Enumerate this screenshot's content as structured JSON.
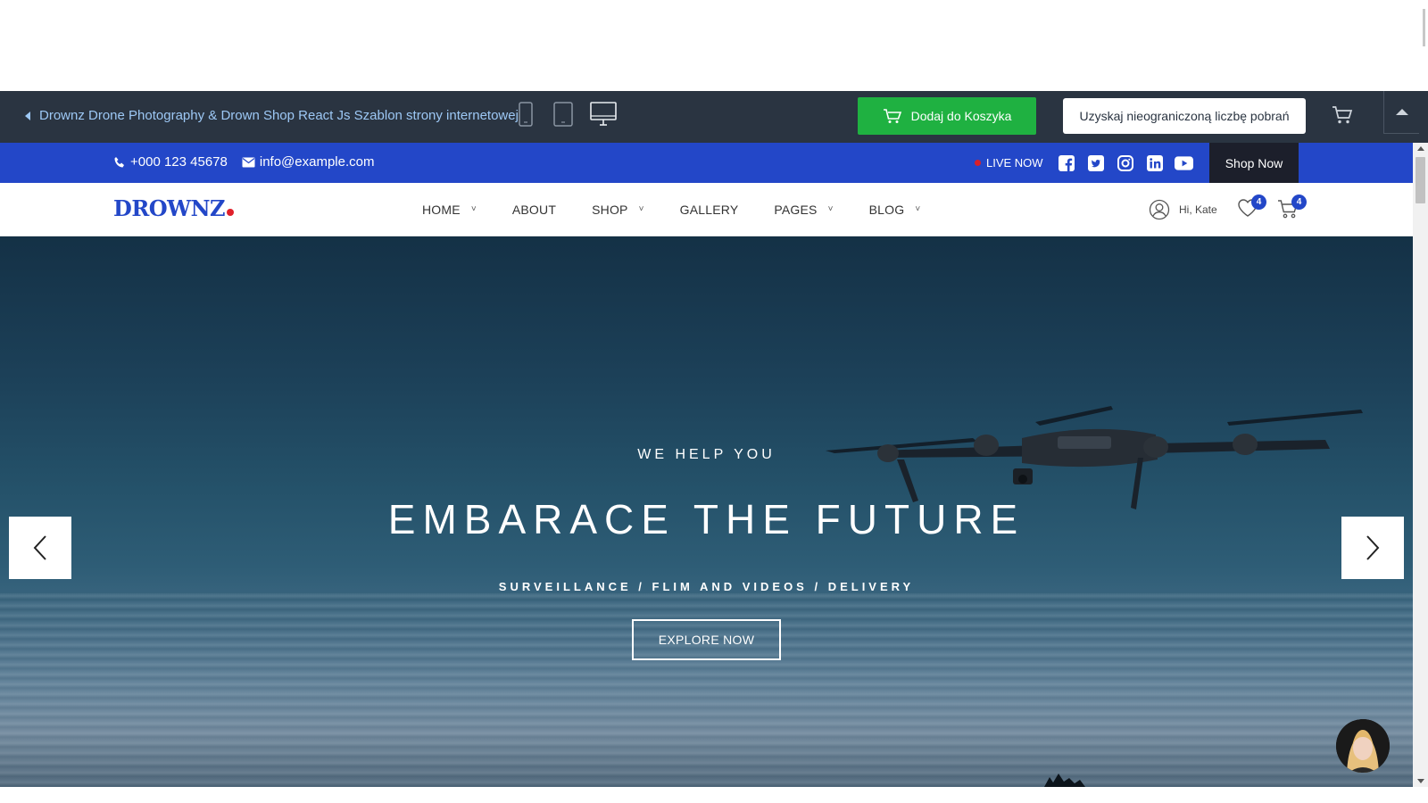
{
  "preview_bar": {
    "back_label": "Drownz Drone Photography & Drown Shop React Js Szablon strony internetowej",
    "devices": [
      "phone-icon",
      "tablet-icon",
      "desktop-icon"
    ],
    "add_to_cart_label": "Dodaj do Koszyka",
    "unlimited_label": "Uzyskaj nieograniczoną liczbę pobrań",
    "colors": {
      "bar": "#2a3441",
      "add_to_cart": "#1fb141",
      "link": "#9dc8f5"
    }
  },
  "info_bar": {
    "phone": "+000 123 45678",
    "email": "info@example.com",
    "live_label": "LIVE NOW",
    "socials": [
      "facebook-icon",
      "twitter-icon",
      "instagram-icon",
      "linkedin-icon",
      "youtube-icon"
    ],
    "shop_now_label": "Shop Now",
    "colors": {
      "bar": "#2347c8",
      "shop_now": "#1c1f2b",
      "live_dot": "#d81f2a"
    }
  },
  "nav": {
    "logo": "DROWNZ",
    "menu": [
      {
        "label": "HOME",
        "dropdown": true
      },
      {
        "label": "ABOUT",
        "dropdown": false
      },
      {
        "label": "SHOP",
        "dropdown": true
      },
      {
        "label": "GALLERY",
        "dropdown": false
      },
      {
        "label": "PAGES",
        "dropdown": true
      },
      {
        "label": "BLOG",
        "dropdown": true
      }
    ],
    "greeting": "Hi, Kate",
    "wishlist_count": "4",
    "cart_count": "4"
  },
  "hero": {
    "subtitle": "WE HELP YOU",
    "title": "EMBARACE THE FUTURE",
    "tags": "SURVEILLANCE / FLIM AND VIDEOS / DELIVERY",
    "cta_label": "EXPLORE NOW"
  }
}
